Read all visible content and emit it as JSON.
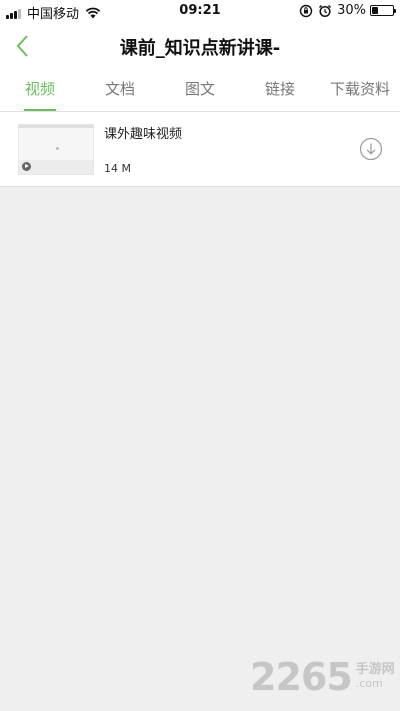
{
  "status_bar": {
    "carrier": "中国移动",
    "time": "09:21",
    "battery_percent": "30%",
    "battery_level": 0.3
  },
  "header": {
    "title": "课前_知识点新讲课-",
    "back_icon": "chevron-left-icon",
    "accent_color": "#6cbd5e"
  },
  "tabs": [
    {
      "label": "视频",
      "active": true
    },
    {
      "label": "文档",
      "active": false
    },
    {
      "label": "图文",
      "active": false
    },
    {
      "label": "链接",
      "active": false
    },
    {
      "label": "下载资料",
      "active": false
    }
  ],
  "items": [
    {
      "title": "课外趣味视频",
      "size": "14 M",
      "thumb_icon": "video-thumbnail",
      "action_icon": "download-icon"
    }
  ],
  "watermark": {
    "main": "2265",
    "cn": "手游网",
    "com": ".com"
  }
}
